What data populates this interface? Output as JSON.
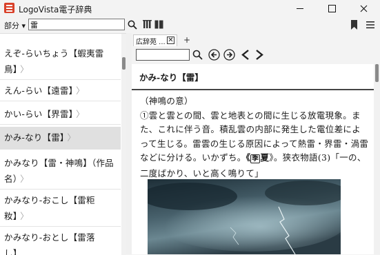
{
  "window": {
    "title": "LogoVista電子辞典"
  },
  "searchbar": {
    "category_label": "部分 ▾",
    "query": "雷"
  },
  "list": {
    "items": [
      {
        "line1": "えぞ‐らいちょう【蝦夷雷",
        "line2": "鳥】"
      },
      {
        "line1": "えん‐らい【遠雷】",
        "line2": ""
      },
      {
        "line1": "かい‐らい【界雷】",
        "line2": ""
      },
      {
        "line1": "かみ‐なり【雷】",
        "line2": ""
      },
      {
        "line1": "かみなり【雷・神鳴】（作品",
        "line2": "名）"
      },
      {
        "line1": "かみなり‐おこし【雷粔",
        "line2": "籹】"
      },
      {
        "line1": "かみなり‐おとし【雷落",
        "line2": "し】"
      }
    ],
    "chevron": "〉"
  },
  "tabs": [
    {
      "label": "広辞苑 ..."
    }
  ],
  "newtab_label": "+",
  "entry": {
    "headword": "かみ‐なり【雷】",
    "paren": "（神鳴の意）",
    "text_a": "①雲と雲との間、雲と地表との間に生じる放電現象。また、これに伴う音。積乱雲の内部に発生した電位差によって生じる。雷雲の生じる原因によって熱雷・界雷・渦雷などに分ける。いかずち。",
    "kigo": "季",
    "season": "夏",
    "text_b": "》。狭衣物語(3)「一の、二度ばかり、いと高く鳴りて」"
  }
}
